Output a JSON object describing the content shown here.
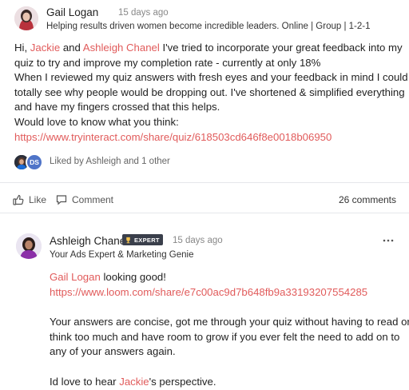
{
  "post": {
    "author": "Gail Logan",
    "time": "15 days ago",
    "subtitle": "Helping results driven women become incredible leaders. Online | Group | 1-2-1",
    "body": {
      "l1_pre": "Hi, ",
      "l1_m1": "Jackie",
      "l1_and": " and ",
      "l1_m2": "Ashleigh Chanel",
      "l1_post": " I've tried to incorporate your great feedback into my",
      "l2": "quiz to try and improve my completion rate - currently at only 18%",
      "l3": "When I reviewed my quiz answers with fresh eyes and your feedback in mind I could",
      "l4": "totally see why people would be dropping out.  I've shortened & simplified everything",
      "l5": "and have my fingers crossed that this helps.",
      "l6": "Would love to know what you think:",
      "link": "https://www.tryinteract.com/share/quiz/618503cd646f8e0018b06950"
    },
    "liked_by": "Liked by Ashleigh and 1 other",
    "liker_initials": "DS",
    "like_label": "Like",
    "comment_label": "Comment",
    "comments_count": "26 comments"
  },
  "comment": {
    "author": "Ashleigh Chanel",
    "badge": "EXPERT",
    "time": "15 days ago",
    "subtitle": "Your Ads Expert & Marketing Genie",
    "mention1": "Gail Logan",
    "mention1_post": " looking good!",
    "link": "https://www.loom.com/share/e7c00ac9d7b648fb9a33193207554285",
    "p2_l1": "Your answers are concise, got me through your quiz without having to read or",
    "p2_l2": "think too much and have room to grow if you ever felt the need to add on to",
    "p2_l3": "any of your answers again.",
    "p3_pre": "Id love to hear ",
    "p3_mention": "Jackie",
    "p3_post": "'s perspective."
  },
  "colors": {
    "accent": "#e15b5b",
    "badge_bg": "#3a3f4b",
    "divider": "#e5e7eb"
  }
}
